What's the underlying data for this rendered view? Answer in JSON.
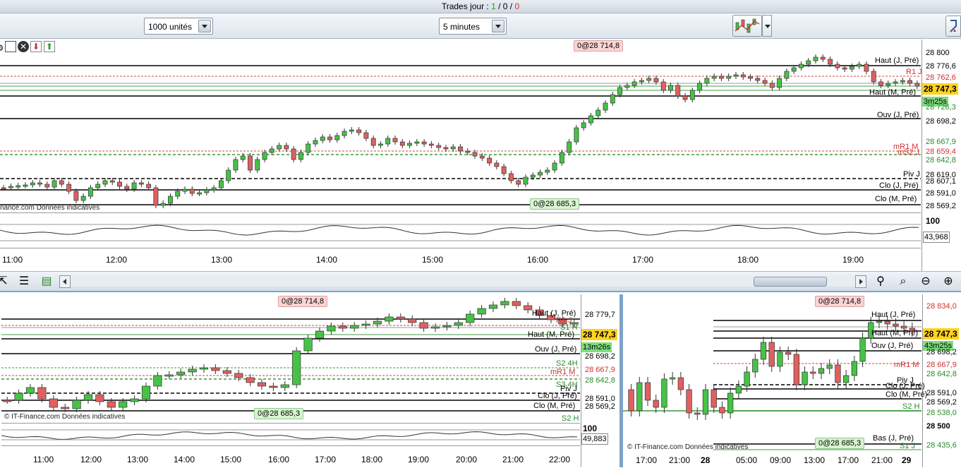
{
  "header": {
    "title_prefix": "Trades jour : ",
    "t1": "1",
    "sl1": " / ",
    "t2": "0",
    "sl2": " / ",
    "t3": "0"
  },
  "toolbar": {
    "units_select": "1000 unités",
    "period_select": "5 minutes"
  },
  "colors": {
    "up": "#46c246",
    "down": "#e06060",
    "current": "#ffd21e",
    "resist": "#d84040",
    "support": "#3a9a3a"
  },
  "main": {
    "price_labels": [
      {
        "text": "28 800",
        "kind": "plain"
      },
      {
        "text": "28 776,6",
        "kind": "plain"
      },
      {
        "text": "28 762,6",
        "kind": "red"
      },
      {
        "text": "28 747,3",
        "kind": "current"
      },
      {
        "text": "3m25s",
        "kind": "timer"
      },
      {
        "text": "28 726,3",
        "kind": "green"
      },
      {
        "text": "28 698,2",
        "kind": "plain"
      },
      {
        "text": "28 667,9",
        "kind": "green"
      },
      {
        "text": "28 659,4",
        "kind": "red"
      },
      {
        "text": "28 642,8",
        "kind": "green"
      },
      {
        "text": "28 619,0",
        "kind": "plain"
      },
      {
        "text": "28 607,1",
        "kind": "plain"
      },
      {
        "text": "28 591,0",
        "kind": "plain"
      },
      {
        "text": "28 569,2",
        "kind": "plain"
      }
    ],
    "line_labels": [
      "Haut (J, Pré)",
      "R1 J",
      "Haut (M, Pré)",
      "Ouv (J, Pré)",
      "mR1 M",
      "mS2 J",
      "Piv J",
      "Clo (J, Pré)",
      "Clo (M, Pré)"
    ],
    "order_top": "0@28 714,8",
    "order_bottom": "0@28 685,3",
    "credit": "nance.com  Données indicatives",
    "osc_top": "100",
    "osc_value": "43,968",
    "time_ticks": [
      "11:00",
      "12:00",
      "13:00",
      "14:00",
      "15:00",
      "16:00",
      "17:00",
      "18:00",
      "19:00"
    ]
  },
  "bl": {
    "price_labels": [
      "28 779,7",
      "28 747,3",
      "13m26s",
      "28 698,2",
      "28 667,9",
      "28 642,8",
      "28 591,0",
      "28 569,2"
    ],
    "line_labels": [
      "Haut (J, Pré)",
      "R1 J",
      "S1 H",
      "Haut (M, Pré)",
      "Ouv (J, Pré)",
      "S2 4H",
      "mR1 M",
      "S3 4H",
      "Piv J",
      "Clo (J, Pré)",
      "Clo (M, Pré)",
      "S2 H"
    ],
    "order_top": "0@28 714,8",
    "order_bottom": "0@28 685,3",
    "credit": "© IT-Finance.com  Données indicatives",
    "osc_top": "100",
    "osc_value": "49,883",
    "time_ticks": [
      "11:00",
      "12:00",
      "13:00",
      "14:00",
      "15:00",
      "16:00",
      "17:00",
      "18:00",
      "19:00",
      "20:00",
      "21:00",
      "22:00"
    ]
  },
  "br": {
    "price_labels": [
      "28 834,0",
      "28 747,3",
      "43m25s",
      "28 698,2",
      "28 667,9",
      "28 642,8",
      "28 591,0",
      "28 569,2",
      "28 538,0",
      "28 500",
      "28 435,6"
    ],
    "line_labels": [
      "Haut (J, Pré)",
      "Haut (M, Pré)",
      "Ouv (J, Pré)",
      "mR1 M",
      "Piv J",
      "Clo (J, Pré)",
      "Clo (M, Pré)",
      "S2 H",
      "Bas (J, Pré)",
      "S1 J"
    ],
    "order_top": "0@28 714,8",
    "order_bottom": "0@28 685,3",
    "credit": "© IT-Finance.com  Données indicatives",
    "time_ticks": [
      "17:00",
      "21:00",
      "28",
      "05:00",
      "09:00",
      "13:00",
      "17:00",
      "21:00",
      "29"
    ]
  }
}
